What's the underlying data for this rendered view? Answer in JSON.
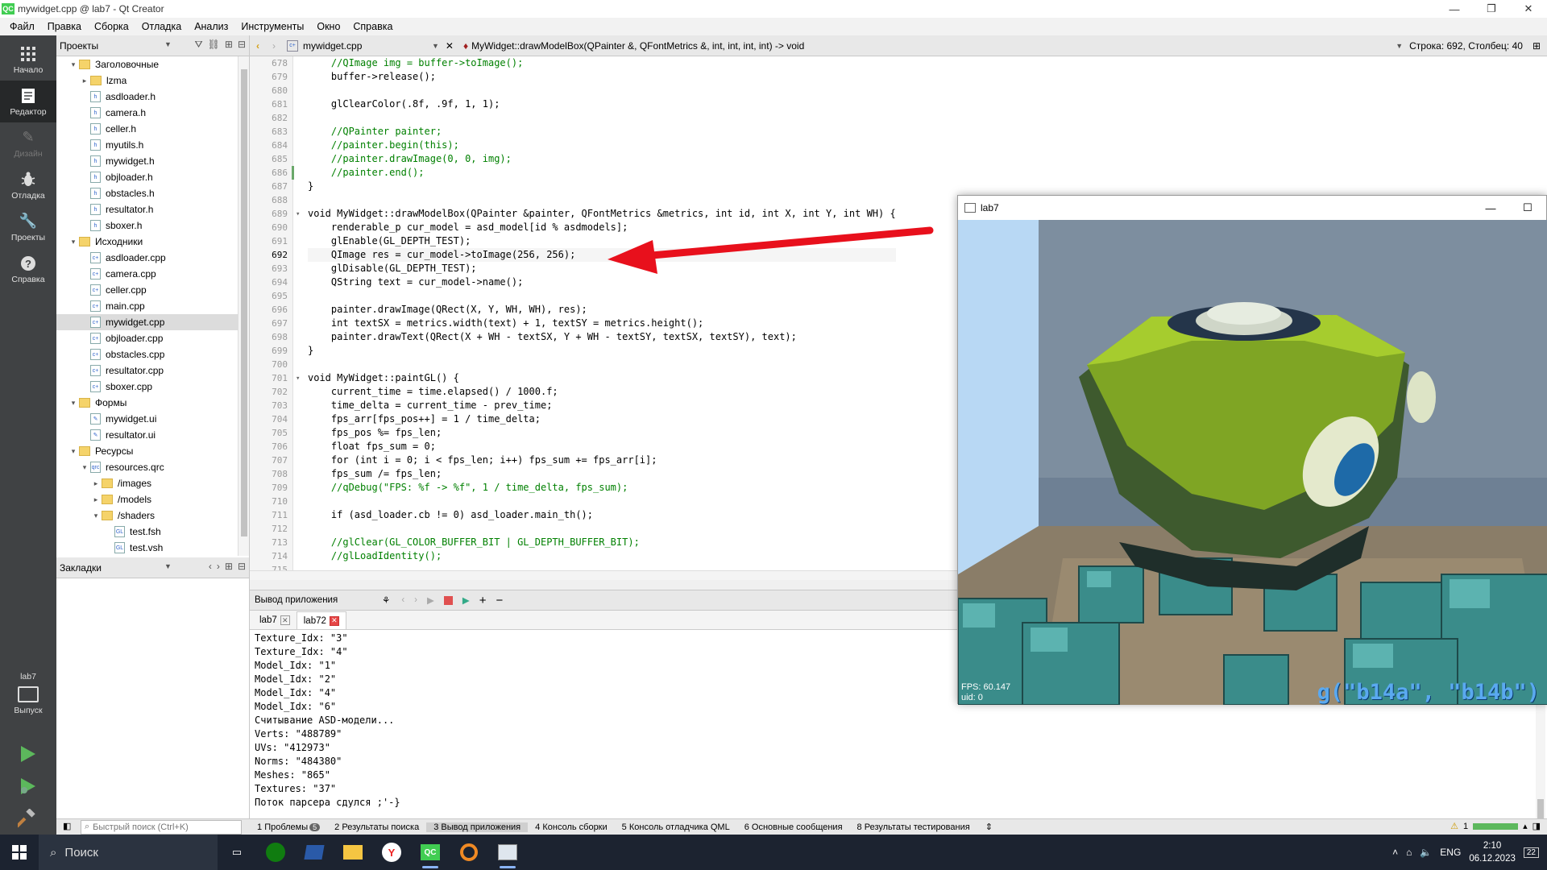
{
  "window": {
    "title": "mywidget.cpp @ lab7 - Qt Creator",
    "app_icon": "QC"
  },
  "menu": [
    "Файл",
    "Правка",
    "Сборка",
    "Отладка",
    "Анализ",
    "Инструменты",
    "Окно",
    "Справка"
  ],
  "modes": [
    {
      "label": "Начало",
      "icon": "grid-icon"
    },
    {
      "label": "Редактор",
      "icon": "editor-icon"
    },
    {
      "label": "Дизайн",
      "icon": "pen-icon"
    },
    {
      "label": "Отладка",
      "icon": "bug-icon"
    },
    {
      "label": "Проекты",
      "icon": "wrench-icon"
    },
    {
      "label": "Справка",
      "icon": "help-icon"
    }
  ],
  "kit": {
    "name": "lab7",
    "label": "Выпуск"
  },
  "projects_panel": {
    "title": "Проекты"
  },
  "bookmarks_panel": {
    "title": "Закладки"
  },
  "tree": [
    {
      "label": "Заголовочные",
      "kind": "group",
      "depth": 1,
      "arrow": "▾"
    },
    {
      "label": "lzma",
      "kind": "folder",
      "depth": 2,
      "arrow": "▸"
    },
    {
      "label": "asdloader.h",
      "kind": "h",
      "depth": 2,
      "arrow": ""
    },
    {
      "label": "camera.h",
      "kind": "h",
      "depth": 2,
      "arrow": ""
    },
    {
      "label": "celler.h",
      "kind": "h",
      "depth": 2,
      "arrow": ""
    },
    {
      "label": "myutils.h",
      "kind": "h",
      "depth": 2,
      "arrow": ""
    },
    {
      "label": "mywidget.h",
      "kind": "h",
      "depth": 2,
      "arrow": ""
    },
    {
      "label": "objloader.h",
      "kind": "h",
      "depth": 2,
      "arrow": ""
    },
    {
      "label": "obstacles.h",
      "kind": "h",
      "depth": 2,
      "arrow": ""
    },
    {
      "label": "resultator.h",
      "kind": "h",
      "depth": 2,
      "arrow": ""
    },
    {
      "label": "sboxer.h",
      "kind": "h",
      "depth": 2,
      "arrow": ""
    },
    {
      "label": "Исходники",
      "kind": "group",
      "depth": 1,
      "arrow": "▾"
    },
    {
      "label": "asdloader.cpp",
      "kind": "cpp",
      "depth": 2,
      "arrow": ""
    },
    {
      "label": "camera.cpp",
      "kind": "cpp",
      "depth": 2,
      "arrow": ""
    },
    {
      "label": "celler.cpp",
      "kind": "cpp",
      "depth": 2,
      "arrow": ""
    },
    {
      "label": "main.cpp",
      "kind": "cpp",
      "depth": 2,
      "arrow": ""
    },
    {
      "label": "mywidget.cpp",
      "kind": "cpp",
      "depth": 2,
      "arrow": "",
      "selected": true
    },
    {
      "label": "objloader.cpp",
      "kind": "cpp",
      "depth": 2,
      "arrow": ""
    },
    {
      "label": "obstacles.cpp",
      "kind": "cpp",
      "depth": 2,
      "arrow": ""
    },
    {
      "label": "resultator.cpp",
      "kind": "cpp",
      "depth": 2,
      "arrow": ""
    },
    {
      "label": "sboxer.cpp",
      "kind": "cpp",
      "depth": 2,
      "arrow": ""
    },
    {
      "label": "Формы",
      "kind": "group",
      "depth": 1,
      "arrow": "▾"
    },
    {
      "label": "mywidget.ui",
      "kind": "ui",
      "depth": 2,
      "arrow": ""
    },
    {
      "label": "resultator.ui",
      "kind": "ui",
      "depth": 2,
      "arrow": ""
    },
    {
      "label": "Ресурсы",
      "kind": "group",
      "depth": 1,
      "arrow": "▾"
    },
    {
      "label": "resources.qrc",
      "kind": "qrc",
      "depth": 2,
      "arrow": "▾"
    },
    {
      "label": "/images",
      "kind": "folder",
      "depth": 3,
      "arrow": "▸"
    },
    {
      "label": "/models",
      "kind": "folder",
      "depth": 3,
      "arrow": "▸"
    },
    {
      "label": "/shaders",
      "kind": "folder",
      "depth": 3,
      "arrow": "▾"
    },
    {
      "label": "test.fsh",
      "kind": "gl",
      "depth": 4,
      "arrow": ""
    },
    {
      "label": "test.vsh",
      "kind": "gl",
      "depth": 4,
      "arrow": ""
    }
  ],
  "editor": {
    "file": "mywidget.cpp",
    "symbol": "MyWidget::drawModelBox(QPainter &, QFontMetrics &, int, int, int, int) -> void",
    "position": "Строка: 692, Столбец: 40",
    "current_line": 692,
    "lines": [
      {
        "n": 678,
        "t": "    //QImage img = buffer->toImage();",
        "c": "cm"
      },
      {
        "n": 679,
        "t": "    buffer->release();",
        "c": ""
      },
      {
        "n": 680,
        "t": "",
        "c": ""
      },
      {
        "n": 681,
        "t": "    glClearColor(.8f, .9f, 1, 1);",
        "c": ""
      },
      {
        "n": 682,
        "t": "",
        "c": ""
      },
      {
        "n": 683,
        "t": "    //QPainter painter;",
        "c": "cm"
      },
      {
        "n": 684,
        "t": "    //painter.begin(this);",
        "c": "cm"
      },
      {
        "n": 685,
        "t": "    //painter.drawImage(0, 0, img);",
        "c": "cm"
      },
      {
        "n": 686,
        "t": "    //painter.end();",
        "c": "cm"
      },
      {
        "n": 687,
        "t": "}",
        "c": ""
      },
      {
        "n": 688,
        "t": "",
        "c": ""
      },
      {
        "n": 689,
        "t": "void MyWidget::drawModelBox(QPainter &painter, QFontMetrics &metrics, int id, int X, int Y, int WH) {",
        "c": ""
      },
      {
        "n": 690,
        "t": "    renderable_p cur_model = asd_model[id % asdmodels];",
        "c": ""
      },
      {
        "n": 691,
        "t": "    glEnable(GL_DEPTH_TEST);",
        "c": ""
      },
      {
        "n": 692,
        "t": "    QImage res = cur_model->toImage(256, 256);",
        "c": ""
      },
      {
        "n": 693,
        "t": "    glDisable(GL_DEPTH_TEST);",
        "c": ""
      },
      {
        "n": 694,
        "t": "    QString text = cur_model->name();",
        "c": ""
      },
      {
        "n": 695,
        "t": "",
        "c": ""
      },
      {
        "n": 696,
        "t": "    painter.drawImage(QRect(X, Y, WH, WH), res);",
        "c": ""
      },
      {
        "n": 697,
        "t": "    int textSX = metrics.width(text) + 1, textSY = metrics.height();",
        "c": ""
      },
      {
        "n": 698,
        "t": "    painter.drawText(QRect(X + WH - textSX, Y + WH - textSY, textSX, textSY), text);",
        "c": ""
      },
      {
        "n": 699,
        "t": "}",
        "c": ""
      },
      {
        "n": 700,
        "t": "",
        "c": ""
      },
      {
        "n": 701,
        "t": "void MyWidget::paintGL() {",
        "c": ""
      },
      {
        "n": 702,
        "t": "    current_time = time.elapsed() / 1000.f;",
        "c": ""
      },
      {
        "n": 703,
        "t": "    time_delta = current_time - prev_time;",
        "c": ""
      },
      {
        "n": 704,
        "t": "    fps_arr[fps_pos++] = 1 / time_delta;",
        "c": ""
      },
      {
        "n": 705,
        "t": "    fps_pos %= fps_len;",
        "c": ""
      },
      {
        "n": 706,
        "t": "    float fps_sum = 0;",
        "c": ""
      },
      {
        "n": 707,
        "t": "    for (int i = 0; i < fps_len; i++) fps_sum += fps_arr[i];",
        "c": ""
      },
      {
        "n": 708,
        "t": "    fps_sum /= fps_len;",
        "c": ""
      },
      {
        "n": 709,
        "t": "    //qDebug(\"FPS: %f -> %f\", 1 / time_delta, fps_sum);",
        "c": "cm"
      },
      {
        "n": 710,
        "t": "",
        "c": ""
      },
      {
        "n": 711,
        "t": "    if (asd_loader.cb != 0) asd_loader.main_th();",
        "c": ""
      },
      {
        "n": 712,
        "t": "",
        "c": ""
      },
      {
        "n": 713,
        "t": "    //glClear(GL_COLOR_BUFFER_BIT | GL_DEPTH_BUFFER_BIT);",
        "c": "cm"
      },
      {
        "n": 714,
        "t": "    //glLoadIdentity();",
        "c": "cm"
      },
      {
        "n": 715,
        "t": "",
        "c": ""
      }
    ]
  },
  "output": {
    "title": "Вывод приложения",
    "tabs": [
      "lab7",
      "lab72"
    ],
    "active_tab": 1,
    "lines": [
      "Texture_Idx: \"3\"",
      "Texture_Idx: \"4\"",
      "Model_Idx: \"1\"",
      "Model_Idx: \"2\"",
      "Model_Idx: \"4\"",
      "Model_Idx: \"6\"",
      "Считывание ASD-модели...",
      "Verts: \"488789\"",
      "UVs: \"412973\"",
      "Norms: \"484380\"",
      "Meshes: \"865\"",
      "Textures: \"37\"",
      "Поток парсера сдулся ;'-}"
    ]
  },
  "statusbar": {
    "search_placeholder": "Быстрый поиск (Ctrl+K)",
    "panes": [
      {
        "num": "1",
        "label": "Проблемы",
        "badge": "5"
      },
      {
        "num": "2",
        "label": "Результаты поиска"
      },
      {
        "num": "3",
        "label": "Вывод приложения",
        "active": true
      },
      {
        "num": "4",
        "label": "Консоль сборки"
      },
      {
        "num": "5",
        "label": "Консоль отладчика QML"
      },
      {
        "num": "6",
        "label": "Основные сообщения"
      },
      {
        "num": "8",
        "label": "Результаты тестирования"
      }
    ],
    "warning_count": "1"
  },
  "app_window": {
    "title": "lab7",
    "fps_text": "FPS: 60.147",
    "uid_text": "uid: 0",
    "overlay_text": "g(\"b14a\", \"b14b\")"
  },
  "taskbar": {
    "search_label": "Поиск",
    "lang": "ENG",
    "time": "2:10",
    "date": "06.12.2023",
    "notif_count": "22"
  },
  "colors": {
    "accent_green": "#41cd52",
    "arrow_red": "#e8101c",
    "mode_bg": "#404244",
    "taskbar_bg": "#1c2330"
  }
}
